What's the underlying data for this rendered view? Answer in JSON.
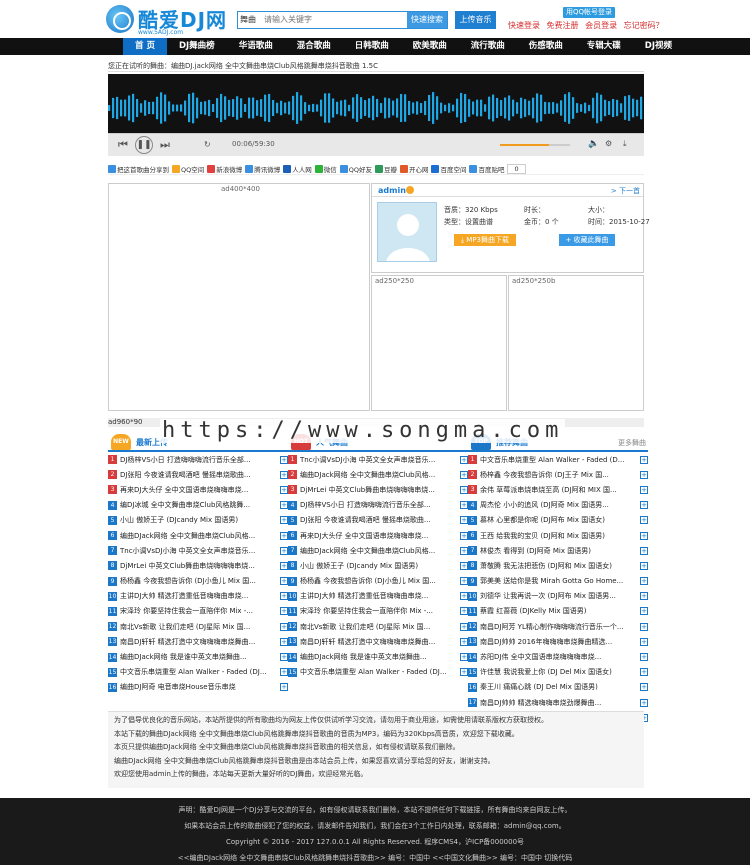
{
  "header": {
    "logo_text": "酷爱DJ网",
    "logo_sub": "www.5ADJ.com",
    "search_type": "舞曲",
    "search_placeholder": "请输入关键字",
    "search_button": "快速搜索",
    "upload_button": "上传音乐",
    "qq_login": "用QQ帐号登录",
    "links": [
      "快速登录",
      "免费注册",
      "会员登录",
      "忘记密码？"
    ]
  },
  "nav": [
    "首 页",
    "DJ舞曲榜",
    "华语歌曲",
    "混合歌曲",
    "日韩歌曲",
    "欧美歌曲",
    "流行歌曲",
    "伤感歌曲",
    "专辑大碟",
    "DJ视频"
  ],
  "now_playing": "您正在试听的舞曲：编曲DJ.jack网络 全中文舞曲串烧Club风格跳舞串烧抖音歌曲      1.5C",
  "player": {
    "time": "00:06/59:30"
  },
  "share": [
    "把这首歌曲分享到",
    "QQ空间",
    "新浪微博",
    "腾讯微博",
    "人人网",
    "微信",
    "QQ好友",
    "豆瓣",
    "开心网",
    "百度空间",
    "百度贴吧",
    "0"
  ],
  "ads": {
    "main": "ad400*400",
    "sub1": "ad250*250",
    "sub2": "ad250*250b",
    "wide": "ad960*90"
  },
  "uploader": {
    "name": "admin",
    "next": "> 下一首",
    "bitrate": "音质：320 Kbps",
    "duration": "时长：",
    "size": "大小：",
    "type": "类型：设置曲谱",
    "coins": "金币：0 个",
    "date": "时间：2015-10-27",
    "download_button": "MP3舞曲下载",
    "favorite_button": "收藏此舞曲"
  },
  "columns": [
    {
      "badge": "NEW",
      "title": "最新上传",
      "more": "",
      "songs": [
        "DJ杨梓VS小日 打造嗨嗨嗨流行音乐全部...",
        "DJ张阳 今夜谁请我喝酒吧 慢摇串烧歌曲...",
        "再来DJ大头仔 全中文国语串烧嗨嗨串烧...",
        "编DJ冰城 全中文舞曲串烧Club风格跳舞...",
        "小山 傲娇王子 (DJcandy Mix 国语男)",
        "编曲DJack网络 全中文舞曲串烧Club风格...",
        "Tnc小调VsDJ小海 中英文全女声串烧音乐...",
        "DjMrLei 中英文Club舞曲串烧嗨嗨嗨串烧...",
        "杨杨鑫 今夜我想告诉你 (DJ小鱼儿 Mix 国...",
        "主讲DJ大帅 精选打造重低音嗨嗨曲串烧...",
        "宋泽玲 你要坚持住我会一直陪伴你 Mix -...",
        "南北Vs新歌 让我们走吧 (DJ星际 Mix 国...",
        "南昌DJ轩轩 精选打造中文嗨嗨嗨串烧舞曲...",
        "编曲DJack网络 我是谁中英文串烧舞曲...",
        "中文音乐串烧重型 Alan Walker - Faded (DJ...",
        "编曲DJ阿奇 电音串烧House音乐串烧"
      ]
    },
    {
      "badge": "HOT",
      "title": "人气舞曲",
      "more": "",
      "songs": [
        "Tnc小调VsDJ小海 中英文全女声串烧音乐...",
        "编曲DJack网络 全中文舞曲串烧Club风格...",
        "DjMrLei 中英文Club舞曲串烧嗨嗨嗨串烧...",
        "DJ杨梓VS小日 打造嗨嗨嗨流行音乐全部...",
        "DJ张阳 今夜谁请我喝酒吧 慢摇串烧歌曲...",
        "再来DJ大头仔 全中文国语串烧嗨嗨串烧...",
        "编曲DJack网络 全中文舞曲串烧Club风格...",
        "小山 傲娇王子 (DJcandy Mix 国语男)",
        "杨杨鑫 今夜我想告诉你 (DJ小鱼儿 Mix 国...",
        "主讲DJ大帅 精选打造重低音嗨嗨曲串烧...",
        "宋泽玲 你要坚持住我会一直陪伴你 Mix -...",
        "南北Vs新歌 让我们走吧 (DJ星际 Mix 国...",
        "南昌DJ轩轩 精选打造中文嗨嗨嗨串烧舞曲...",
        "编曲DJack网络 我是谁中英文串烧舞曲...",
        "中文音乐串烧重型 Alan Walker - Faded (DJ..."
      ]
    },
    {
      "badge": "TOP",
      "title": "推荐舞曲",
      "more": "更多舞曲",
      "songs": [
        "中文音乐串烧重型 Alan Walker - Faded (D...",
        "杨梓鑫 今夜我想告诉你 (DJ王子 Mix 国...",
        "余伟 草莓派串烧串烧至高 (DJ阿和 MIX 国...",
        "周杰伦 小小的追风 (DJ阿奇 Mix 国语男...",
        "慕林 心里都是你呢 (DJ阿布 Mix 国语女)",
        "王西 给我我的宝贝 (DJ阿和 Mix 国语男)",
        "林俊杰 看得到 (DJ阿奇 Mix 国语男)",
        "萧敬腾 我无法把悲伤 (DJ阿和 Mix 国语女)",
        "郭美美 送给你是我 Mirah Gotta Go Home...",
        "刘德华 让我再说一次 (DJ阿布 Mix 国语男...",
        "蔡霞 红蔷薇 (DJKelly Mix 国语男)",
        "南昌DJ阿芳 YL精心制作嗨嗨嗨流行音乐一个...",
        "南昌DJ帅帅 2016年嗨嗨嗨串烧舞曲精选...",
        "苏阳DJ伟 全中文国语串烧嗨嗨嗨串烧...",
        "许佳慧 我说我爱上你 (DJ Del Mix 国语女)",
        "秦王川 痛痛心跳 (DJ Del Mix 国语男)",
        "南昌DJ帅帅 精选嗨嗨嗨串烧劲爆舞曲...",
        "六哲 该怎么办 (DJ阿和 Mix 国语男)"
      ]
    }
  ],
  "section_label": "ad960*90",
  "description": [
    "为了倡导优良化的音乐网站，本站所提供的所有歌曲均为网友上传仅供试听学习交流，请勿用于商业用途，如需使用请联系版权方获取授权。",
    "本站下载的舞曲DJack网络 全中文舞曲串烧Club风格跳舞串烧抖音歌曲的音质为MP3，编码为320Kbps高音质，欢迎您下载收藏。",
    "本页只提供编曲DJack网络 全中文舞曲串烧Club风格跳舞串烧抖音歌曲的相关信息，如有侵权请联系我们删除。",
    "编曲DJack网络 全中文舞曲串烧Club风格跳舞串烧抖音歌曲是由本站会员上传，如果您喜欢请分享给您的好友，谢谢支持。",
    "欢迎您使用admin上传的舞曲，本站每天更新大量好听的DJ舞曲，欢迎经常光临。"
  ],
  "footer": [
    "声明：酷爱DJ网是一个DJ分享与交流的平台，如有侵权请联系我们删除，本站不提供任何下载链接，所有舞曲均来自网友上传。",
    "如果本站会员上传的歌曲侵犯了您的权益，请发邮件告知我们，我们会在3个工作日内处理，联系邮箱：admin@qq.com。",
    "Copyright © 2016 - 2017 127.0.0.1 All Rights Reserved. 程序CMS4，沪ICP备000000号",
    "<<编曲DJack网络 全中文舞曲串烧Club风格跳舞串烧抖音歌曲>> 编号：中国中 <<中国文化舞曲>> 编号：中国中 切换代码"
  ]
}
